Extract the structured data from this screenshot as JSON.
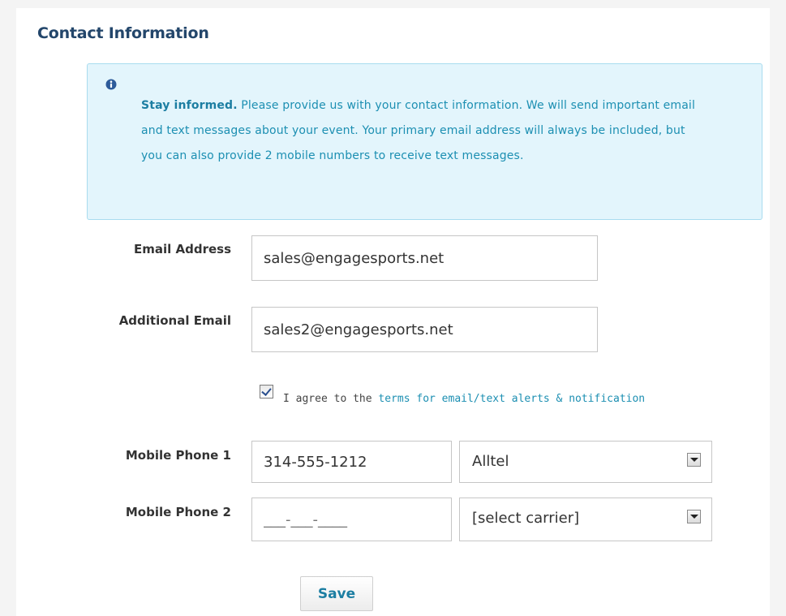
{
  "section": {
    "title": "Contact Information"
  },
  "info": {
    "icon": "info-circle-icon",
    "bold_text": "Stay informed.",
    "body_text": " Please provide us with your contact information. We will send important email and text messages about your event. Your primary email address will always be included, but you can also provide 2 mobile numbers to receive text messages."
  },
  "form": {
    "email": {
      "label": "Email Address",
      "value": "sales@engagesports.net"
    },
    "additional_email": {
      "label": "Additional Email",
      "value": "sales2@engagesports.net"
    },
    "agree": {
      "checked": true,
      "prefix": "I agree to the ",
      "link_text": "terms for email/text alerts & notification"
    },
    "phone1": {
      "label": "Mobile Phone 1",
      "value": "314-555-1212",
      "carrier": "Alltel"
    },
    "phone2": {
      "label": "Mobile Phone 2",
      "placeholder": "___-___-____",
      "carrier": "[select carrier]"
    },
    "save_label": "Save"
  },
  "colors": {
    "title": "#23466b",
    "info_bg": "#e3f5fc",
    "info_border": "#a9dcef",
    "link": "#1c8fb2"
  }
}
